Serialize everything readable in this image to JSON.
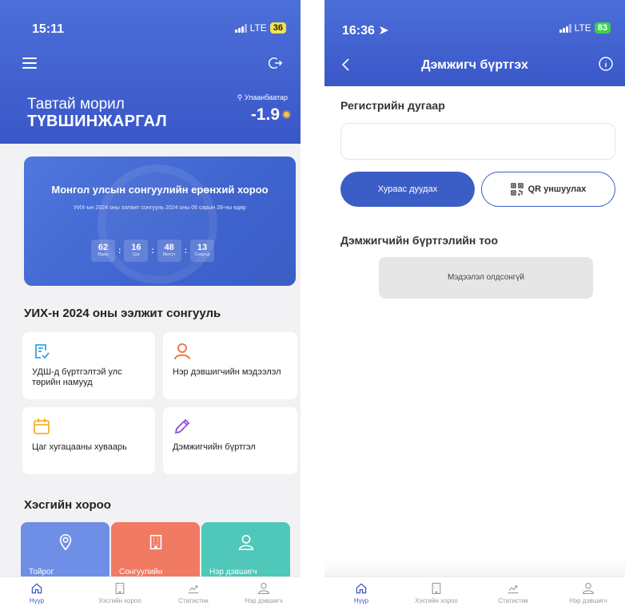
{
  "left": {
    "status": {
      "time": "15:11",
      "network": "LTE",
      "battery": "36"
    },
    "header": {
      "greeting": "Тавтай морил",
      "username": "ТҮВШИНЖАРГАЛ",
      "city": "Улаанбаатар",
      "temperature": "-1.9"
    },
    "banner": {
      "title": "Монгол улсын сонгуулийн ерөнхий хороо",
      "subtitle": "УИХ-ын 2024 оны ээлжит сонгууль 2024 оны 06 сарын 28-ны өдөр",
      "countdown": [
        {
          "value": "62",
          "unit": "Өдөр"
        },
        {
          "value": "16",
          "unit": "Цаг"
        },
        {
          "value": "48",
          "unit": "Минут"
        },
        {
          "value": "13",
          "unit": "Секунд"
        }
      ]
    },
    "section1_title": "УИХ-н 2024 оны ээлжит сонгууль",
    "tiles": [
      {
        "label": "УДШ-д бүртгэлтэй улс төрийн намууд",
        "icon": "document-check-icon",
        "color": "#3aa0e8"
      },
      {
        "label": "Нэр дэвшигчийн мэдээлэл",
        "icon": "person-icon",
        "color": "#f07b4b"
      },
      {
        "label": "Цаг хугацааны хуваарь",
        "icon": "calendar-icon",
        "color": "#f2b134"
      },
      {
        "label": "Дэмжигчийн бүртгэл",
        "icon": "pencil-icon",
        "color": "#8b4fe0"
      }
    ],
    "section2_title": "Хэсгийн хороо",
    "cards": [
      {
        "label": "Тойрог",
        "icon": "location-pin-icon",
        "color": "#6f8fe6"
      },
      {
        "label": "Сонгуулийн",
        "icon": "building-icon",
        "color": "#f07a62"
      },
      {
        "label": "Нэр дэвшигч",
        "icon": "person-icon",
        "color": "#4fc7b9"
      }
    ]
  },
  "tabs": [
    {
      "label": "Нүүр",
      "icon": "home-icon"
    },
    {
      "label": "Хэсгийн хороо",
      "icon": "building-icon"
    },
    {
      "label": "Статистик",
      "icon": "chart-icon"
    },
    {
      "label": "Нэр дэвшигч",
      "icon": "person-icon"
    }
  ],
  "right": {
    "status": {
      "time": "16:36",
      "network": "LTE",
      "battery": "83"
    },
    "title": "Дэмжигч бүртгэх",
    "reg_label": "Регистрийн дугаар",
    "reg_value": "",
    "btn_search": "Хурааc дуудах",
    "btn_qr": "QR уншуулах",
    "count_title": "Дэмжигчийн бүртгэлийн тоо",
    "empty_text": "Мэдээлэл олдсонгүй"
  },
  "colors": {
    "primary": "#3b5ec6",
    "header": "#4c6fd9"
  }
}
